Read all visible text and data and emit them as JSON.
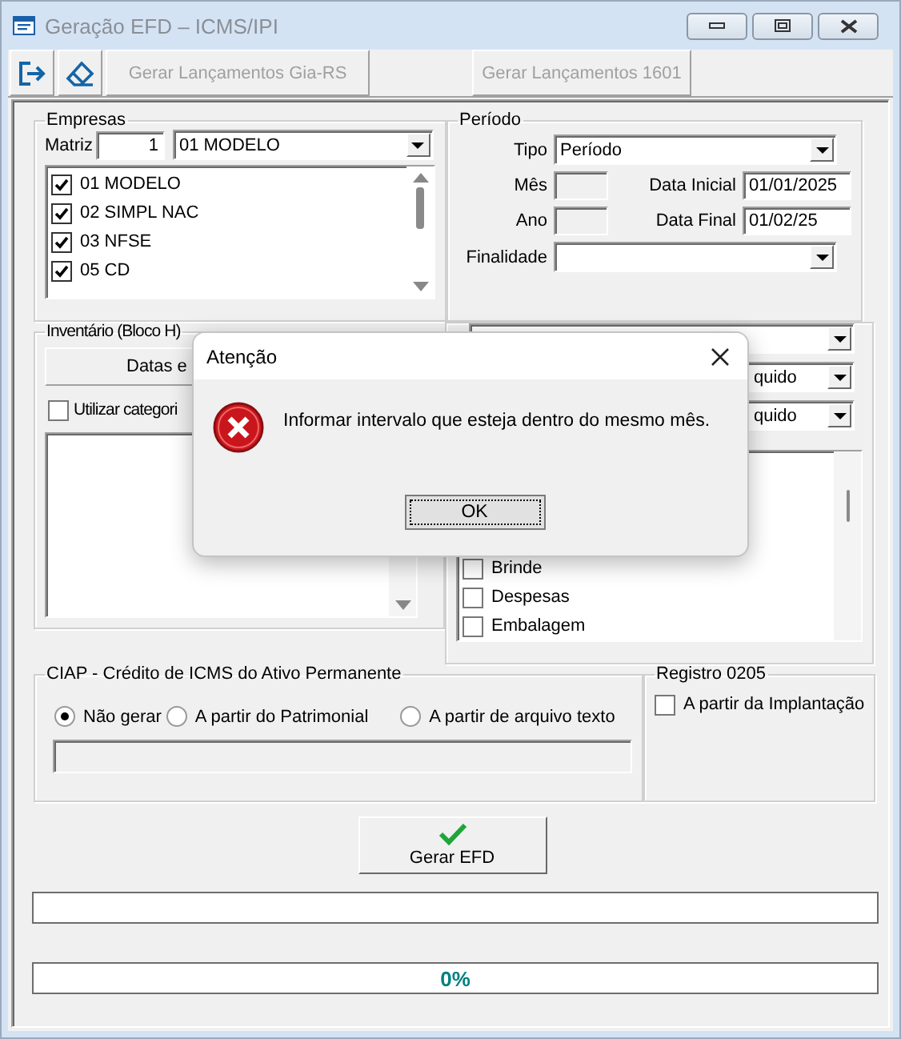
{
  "window": {
    "title": "Geração EFD – ICMS/IPI"
  },
  "toolbar": [
    {
      "kind": "exit"
    },
    {
      "kind": "eraser"
    },
    {
      "kind": "text",
      "label": "Gerar Lançamentos Gia-RS",
      "disabled": true
    },
    {
      "kind": "text",
      "label": "Gerar Lançamentos 1601",
      "disabled": true
    }
  ],
  "empresas": {
    "title": "Empresas",
    "matriz_label": "Matriz",
    "matriz_value": "1",
    "company": "01 MODELO",
    "items": [
      {
        "label": "01 MODELO",
        "checked": true
      },
      {
        "label": "02 SIMPL NAC",
        "checked": true
      },
      {
        "label": "03 NFSE",
        "checked": true
      },
      {
        "label": "05 CD",
        "checked": true
      }
    ]
  },
  "periodo": {
    "title": "Período",
    "tipo_label": "Tipo",
    "tipo": "Período",
    "mes_label": "Mês",
    "ano_label": "Ano",
    "data_inicial_label": "Data Inicial",
    "data_inicial": "01/01/2025",
    "data_final_label": "Data Final",
    "data_final": "01/02/25",
    "finalidade_label": "Finalidade"
  },
  "inventario": {
    "title": "Inventário (Bloco H)",
    "button": "Datas e",
    "checkbox": {
      "label": "Utilizar categori",
      "checked": false
    }
  },
  "right_panel": {
    "dropdowns": [
      "quido",
      "quido"
    ],
    "items": [
      {
        "label": "Brinde",
        "checked": false
      },
      {
        "label": "Despesas",
        "checked": false
      },
      {
        "label": "Embalagem",
        "checked": false
      }
    ]
  },
  "ciap": {
    "title": "CIAP - Crédito de ICMS do Ativo Permanente",
    "options": [
      {
        "label": "Não gerar",
        "selected": true
      },
      {
        "label": "A partir do Patrimonial",
        "selected": false
      },
      {
        "label": "A partir de arquivo texto",
        "selected": false
      }
    ]
  },
  "registro": {
    "title": "Registro 0205",
    "checkbox": {
      "label": "A partir da Implantação",
      "checked": false
    }
  },
  "generate_button": "Gerar EFD",
  "progress": [
    {
      "level": 0
    },
    {
      "level": 0,
      "reading": "0%"
    }
  ],
  "dialog": {
    "title": "Atenção",
    "message": "Informar intervalo que esteja dentro do mesmo mês.",
    "button": "OK"
  }
}
